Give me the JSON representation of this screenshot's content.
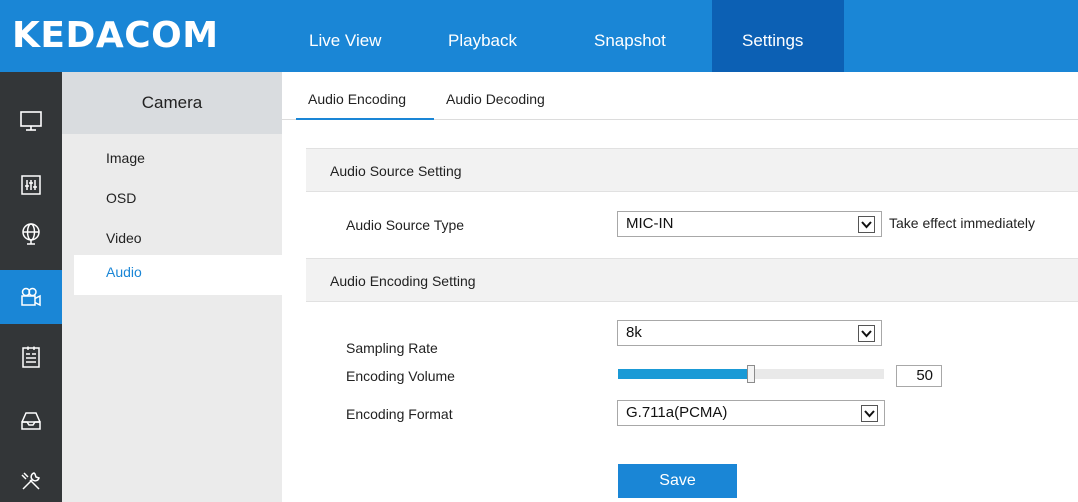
{
  "brand": {
    "logo_text": "KEDACOM",
    "accent_color": "#1a86d6",
    "nav_active_color": "#0c60b4"
  },
  "topnav": {
    "items": [
      {
        "label": "Live View",
        "active": false
      },
      {
        "label": "Playback",
        "active": false
      },
      {
        "label": "Snapshot",
        "active": false
      },
      {
        "label": "Settings",
        "active": true
      }
    ]
  },
  "rail": {
    "items": [
      {
        "icon": "monitor-icon",
        "active": false
      },
      {
        "icon": "equalizer-icon",
        "active": false
      },
      {
        "icon": "network-globe-icon",
        "active": false
      },
      {
        "icon": "camera-icon",
        "active": true
      },
      {
        "icon": "event-log-icon",
        "active": false
      },
      {
        "icon": "storage-icon",
        "active": false
      },
      {
        "icon": "tools-icon",
        "active": false
      }
    ]
  },
  "submenu": {
    "title": "Camera",
    "items": [
      {
        "label": "Image",
        "active": false
      },
      {
        "label": "OSD",
        "active": false
      },
      {
        "label": "Video",
        "active": false
      },
      {
        "label": "Audio",
        "active": true
      }
    ]
  },
  "tabs": [
    {
      "label": "Audio Encoding",
      "active": true
    },
    {
      "label": "Audio Decoding",
      "active": false
    }
  ],
  "audio_source": {
    "section_title": "Audio Source Setting",
    "type_label": "Audio Source Type",
    "type_value": "MIC-IN",
    "hint": "Take effect immediately"
  },
  "audio_encoding": {
    "section_title": "Audio Encoding Setting",
    "sampling_rate_label": "Sampling Rate",
    "sampling_rate_value": "8k",
    "volume_label": "Encoding Volume",
    "volume_value": "50",
    "volume_fraction": 0.5,
    "format_label": "Encoding Format",
    "format_value": "G.711a(PCMA)"
  },
  "actions": {
    "save_label": "Save"
  }
}
